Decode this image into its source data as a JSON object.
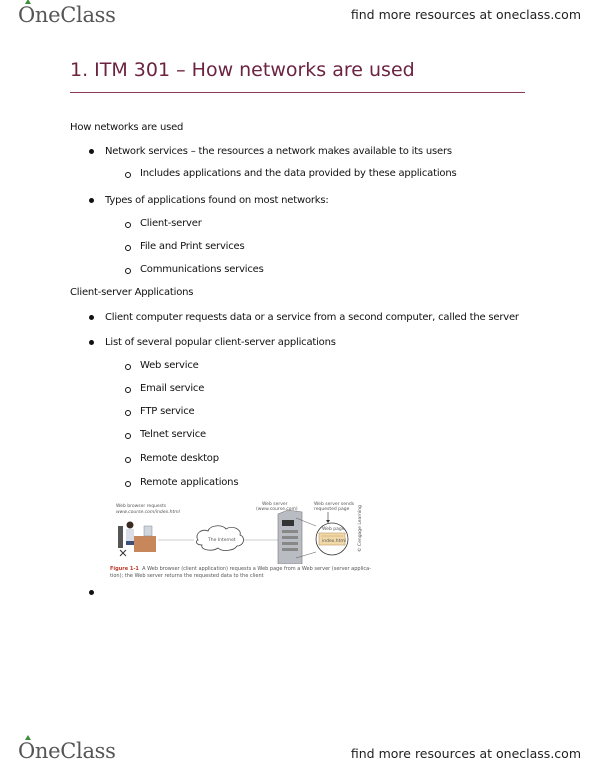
{
  "header": {
    "logo_text": "OneClass",
    "tagline": "find more resources at oneclass.com"
  },
  "document": {
    "title": "1. ITM 301 – How networks are used",
    "sections": [
      {
        "heading": "How networks are used",
        "bullets": [
          {
            "text": "Network services – the resources a network makes available to its users",
            "sub": [
              "Includes applications and the data provided by these applications"
            ]
          },
          {
            "text": "Types of applications found on most networks:",
            "sub": [
              "Client-server",
              "File and Print services",
              "Communications services"
            ]
          }
        ]
      },
      {
        "heading": "Client-server Applications",
        "bullets": [
          {
            "text": "Client computer requests data or a service from a second computer, called the server",
            "sub": []
          },
          {
            "text": "List of several popular client-server applications",
            "sub": [
              "Web service",
              "Email service",
              "FTP service",
              "Telnet service",
              "Remote desktop",
              "Remote applications"
            ]
          }
        ]
      }
    ],
    "figure": {
      "client_label_1": "Web browser requests",
      "client_label_2": "www.course.com/index.html",
      "cloud_label": "The Internet",
      "server_label_1": "Web server",
      "server_label_2": "(www.course.com)",
      "sends_label_1": "Web server sends",
      "sends_label_2": "requested page",
      "page_label": "Web page",
      "page_file": "index.html",
      "credit": "© Cengage Learning",
      "caption_label": "Figure 1-1",
      "caption_line_1": "A Web browser (client application) requests a Web page from a Web server (server applica-",
      "caption_line_2": "tion); the Web server returns the requested data to the client"
    }
  },
  "footer": {
    "logo_text": "OneClass",
    "tagline": "find more resources at oneclass.com"
  },
  "colors": {
    "title": "#6b2340",
    "rule": "#8a3a58",
    "logo_leaf": "#3a8f3a",
    "caption_label": "#c0392b"
  }
}
